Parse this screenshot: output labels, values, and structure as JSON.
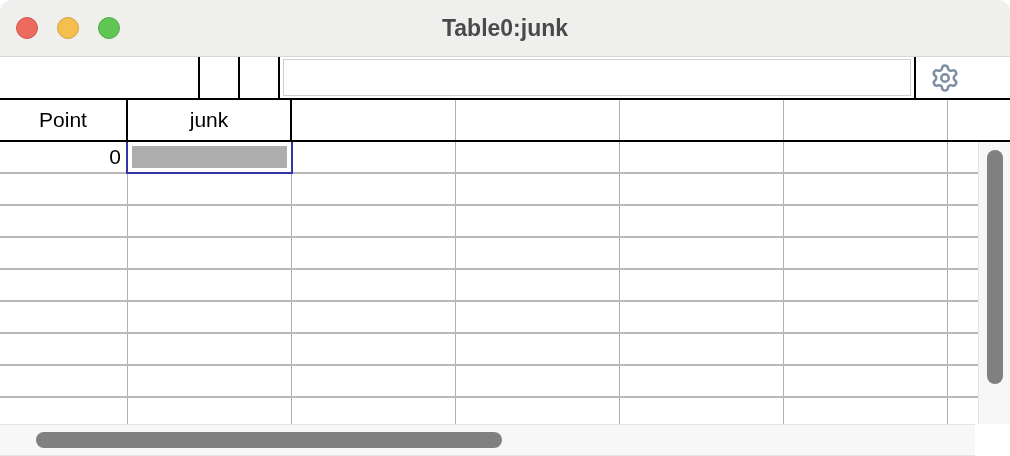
{
  "window": {
    "title": "Table0:junk"
  },
  "table": {
    "columns": [
      {
        "label": "Point"
      },
      {
        "label": "junk"
      }
    ],
    "rows": [
      {
        "point": "0",
        "selected": true
      }
    ]
  }
}
